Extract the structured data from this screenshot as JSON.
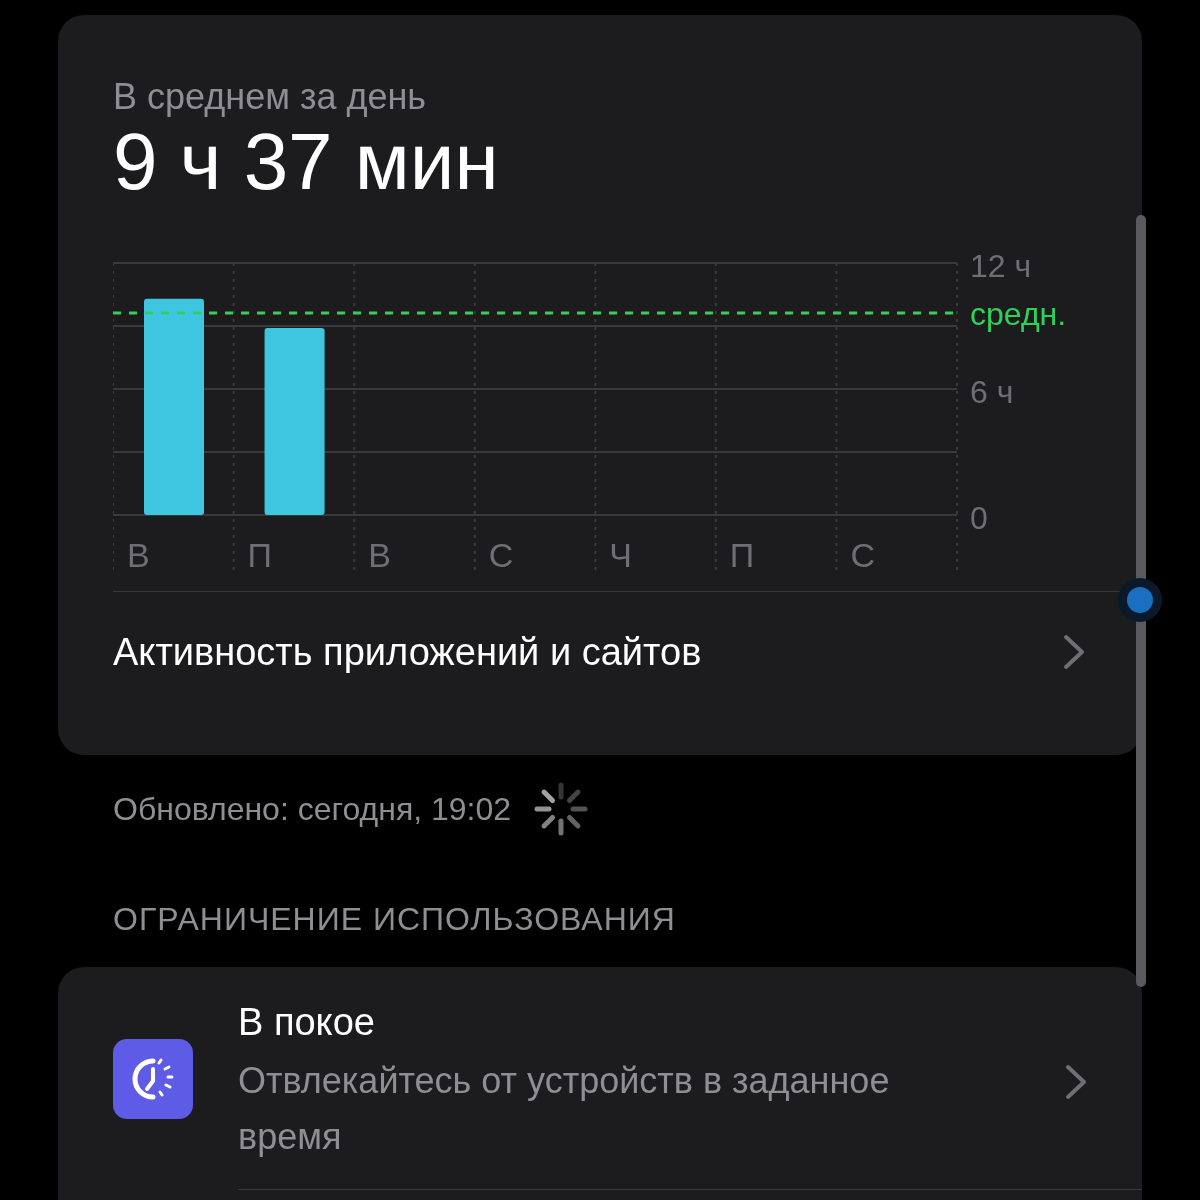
{
  "summary": {
    "label": "В среднем за день",
    "value": "9 ч 37 мин"
  },
  "chart_data": {
    "type": "bar",
    "categories": [
      "В",
      "П",
      "В",
      "С",
      "Ч",
      "П",
      "С"
    ],
    "series": [
      {
        "color": "#3ec6e0",
        "values": [
          10.3,
          8.9,
          null,
          null,
          null,
          null,
          null
        ]
      }
    ],
    "ylim": [
      0,
      12
    ],
    "yticks": [
      {
        "value": 0,
        "label": "0"
      },
      {
        "value": 6,
        "label": "6 ч"
      },
      {
        "value": 12,
        "label": "12 ч"
      }
    ],
    "ref_lines": [
      {
        "axis": "y",
        "value": 9.62,
        "label": "средн.",
        "color": "#30d158"
      }
    ]
  },
  "activity_link": {
    "label": "Активность приложений и сайтов"
  },
  "updated": {
    "text": "Обновлено: сегодня, 19:02",
    "loading": true
  },
  "section_header": "ОГРАНИЧЕНИЕ ИСПОЛЬЗОВАНИЯ",
  "limits": [
    {
      "title": "В покое",
      "subtitle": "Отвлекайтесь от устройств в заданное время"
    }
  ]
}
